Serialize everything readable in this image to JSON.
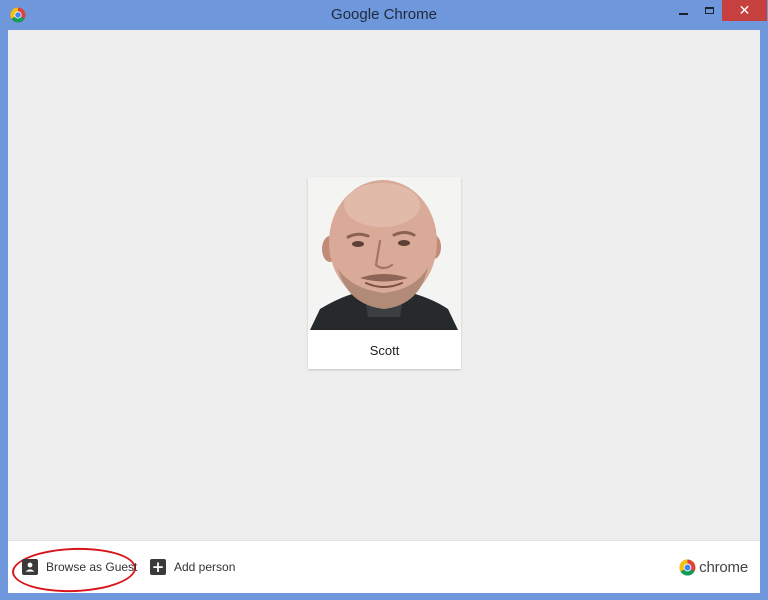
{
  "window": {
    "title": "Google Chrome",
    "controls": {
      "minimize": "minimize",
      "maximize": "maximize",
      "close": "✕"
    }
  },
  "profiles": [
    {
      "name": "Scott",
      "avatar": "user-photo"
    }
  ],
  "footer": {
    "guest_label": "Browse as Guest",
    "add_label": "Add person",
    "brand_label": "chrome"
  },
  "annotation": {
    "shape": "ellipse",
    "color": "#d8141b",
    "target": "Browse as Guest"
  },
  "colors": {
    "titlebar": "#6f97db",
    "close_button": "#c74040",
    "background": "#eeeeee",
    "chrome_red": "#db4437",
    "chrome_yellow": "#f4c20d",
    "chrome_green": "#0f9d58",
    "chrome_blue": "#4285f4"
  }
}
